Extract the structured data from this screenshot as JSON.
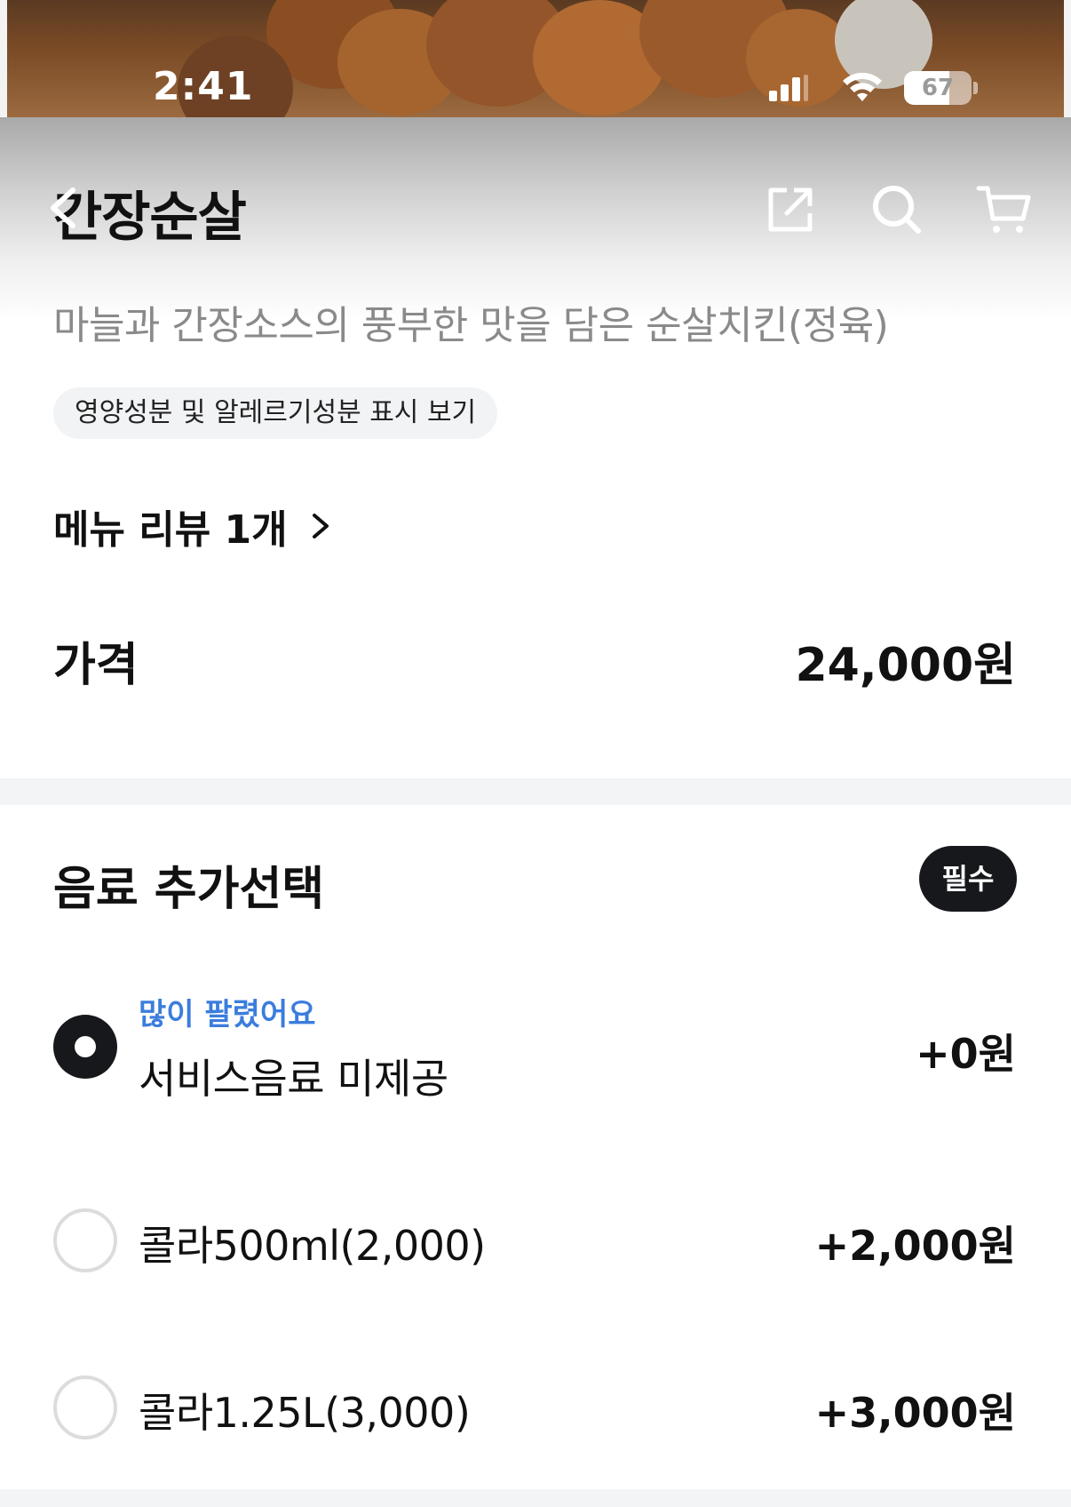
{
  "status_bar": {
    "time": "2:41",
    "battery_percent": "67",
    "battery_level": 0.67,
    "signal_bars": 3,
    "wifi": true
  },
  "header": {
    "title": "간장순살",
    "back_icon": "back-arrow-icon",
    "actions": [
      {
        "name": "share",
        "icon": "share-icon"
      },
      {
        "name": "search",
        "icon": "search-icon"
      },
      {
        "name": "cart",
        "icon": "cart-icon"
      }
    ]
  },
  "menu": {
    "description": "마늘과 간장소스의 풍부한 맛을 담은 순살치킨(정육)",
    "nutrition_chip": "영양성분 및 알레르기성분 표시 보기",
    "review_link": "메뉴 리뷰 1개",
    "price_label": "가격",
    "price_value": "24,000원"
  },
  "drink_section": {
    "title": "음료 추가선택",
    "required_badge": "필수",
    "options": [
      {
        "tag": "많이 팔렸어요",
        "label": "서비스음료 미제공",
        "price": "+0원",
        "selected": true
      },
      {
        "tag": "",
        "label": "콜라500ml(2,000)",
        "price": "+2,000원",
        "selected": false
      },
      {
        "tag": "",
        "label": "콜라1.25L(3,000)",
        "price": "+3,000원",
        "selected": false
      }
    ]
  },
  "colors": {
    "accent_blue": "#3b7ddd",
    "dark": "#16181b",
    "muted_text": "#8a8a8a",
    "divider": "#f3f4f6"
  }
}
